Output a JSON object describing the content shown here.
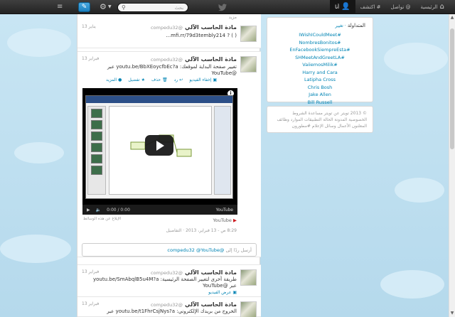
{
  "nav": {
    "home": "الرئيسية",
    "connect": "@ تواصل",
    "discover": "# اكتشف",
    "me": "أنا"
  },
  "search": {
    "placeholder": "بحث"
  },
  "trends": {
    "title": "المتداولة",
    "change": "· تغيير",
    "items": [
      "IWishICouldMeet#",
      "NombresBonitos#",
      "EnFacebookSiempreEsta#",
      "SHMeetAndGreetLA#",
      "VaiiemosMilik#",
      "Harry and Cara",
      "Latipha Cross",
      "Chris Bosh",
      "Jake Allen",
      "Bill Russell"
    ]
  },
  "footer": {
    "text": "© 2013 تويتر عن تويتر مساعدة الشروط الخصوصية المدونة الحالة التطبيقات الموارد وظائف المعلنون الأعمال وسائل الإعلام #مطورون"
  },
  "tweets": [
    {
      "name": "مادة الحاسب الآلي",
      "handle": "@compedu32",
      "time": "13 يناير",
      "text": "( ) ? mfi.rr/79d3tembly214...",
      "sub": "مزيد"
    },
    {
      "name": "مادة الحاسب الآلي",
      "handle": "@compedu32",
      "time": "13 فبراير",
      "text": "تغيير صفحة البداية لموقعك: youtu.be/BbXEoycfbEc?a عبر @YouTube",
      "actions": {
        "hide": "إخفاء الفيديو",
        "reply": "رد",
        "delete": "حذف",
        "favorite": "تفضيل",
        "more": "المزيد"
      },
      "video": {
        "time": "0:00 / 0:00",
        "brand": "YouTube"
      },
      "source": "YouTube",
      "flag": "الإبلاغ عن هذه الوسائط",
      "date": "8:29 ص - 13 فبراير، 2013 · التفاصيل",
      "reply_placeholder": "أرسل ردًا إلى",
      "reply_mentions": "@compedu32 @YouTube"
    },
    {
      "name": "مادة الحاسب الآلي",
      "handle": "@compedu32",
      "time": "13 فبراير",
      "text": "طريقة أخرى لتغيير الصفحة الرئيسية: youtu.be/SmAbqlB5u4M?a عبر @YouTube",
      "sub": "عرض الفيديو"
    },
    {
      "name": "مادة الحاسب الآلي",
      "handle": "@compedu32",
      "time": "13 فبراير",
      "text": "الخروج من بريدك الإلكتروني: youtu.be/t1FhrCsjNys?a عبر"
    }
  ]
}
